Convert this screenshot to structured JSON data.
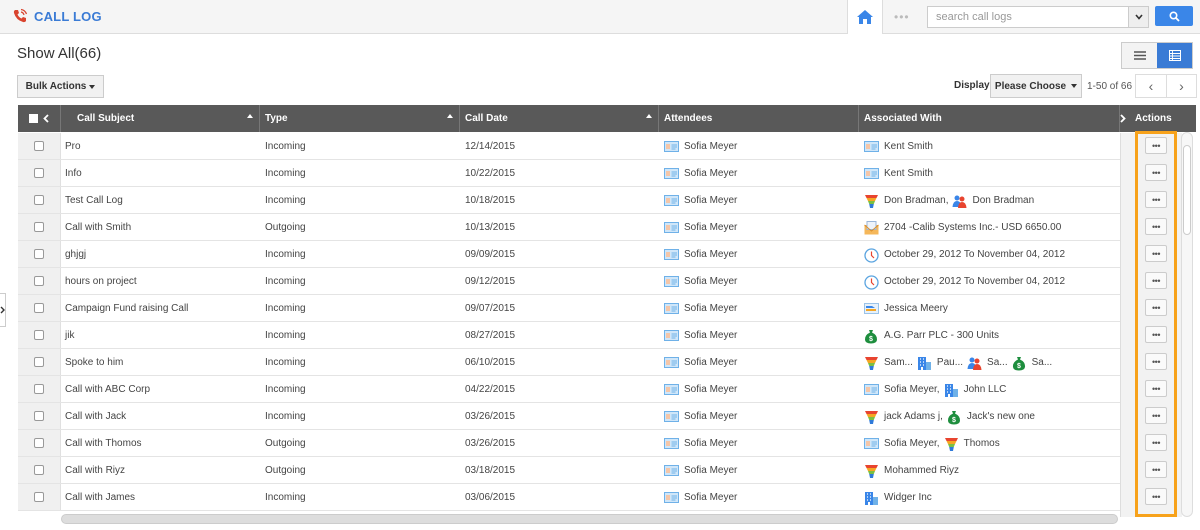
{
  "header": {
    "app_title": "CALL LOG",
    "search_placeholder": "search call logs",
    "more_label": "•••"
  },
  "toolbar": {
    "show_all": "Show All(66)",
    "bulk_actions": "Bulk Actions",
    "display_label": "Display",
    "display_select": "Please Choose",
    "page_count": "1-50 of 66",
    "prev": "‹",
    "next": "›"
  },
  "table": {
    "columns": [
      "Call Subject",
      "Type",
      "Call Date",
      "Attendees",
      "Associated With",
      "Actions"
    ],
    "action_label": "•••",
    "rows": [
      {
        "subject": "Pro",
        "type": "Incoming",
        "date": "12/14/2015",
        "attendee": "Sofia Meyer",
        "assoc": [
          {
            "icon": "contact-card-icon",
            "text": "Kent Smith"
          }
        ]
      },
      {
        "subject": "Info",
        "type": "Incoming",
        "date": "10/22/2015",
        "attendee": "Sofia Meyer",
        "assoc": [
          {
            "icon": "contact-card-icon",
            "text": "Kent Smith"
          }
        ]
      },
      {
        "subject": "Test Call Log",
        "type": "Incoming",
        "date": "10/18/2015",
        "attendee": "Sofia Meyer",
        "assoc": [
          {
            "icon": "lead-funnel-icon",
            "text": "Don Bradman,"
          },
          {
            "icon": "people-icon",
            "text": "Don Bradman"
          }
        ]
      },
      {
        "subject": "Call with Smith",
        "type": "Outgoing",
        "date": "10/13/2015",
        "attendee": "Sofia Meyer",
        "assoc": [
          {
            "icon": "invoice-envelope-icon",
            "text": "2704 -Calib Systems Inc.- USD 6650.00"
          }
        ]
      },
      {
        "subject": "ghjgj",
        "type": "Incoming",
        "date": "09/09/2015",
        "attendee": "Sofia Meyer",
        "assoc": [
          {
            "icon": "clock-icon",
            "text": "October 29, 2012 To November 04, 2012"
          }
        ]
      },
      {
        "subject": "hours on project",
        "type": "Incoming",
        "date": "09/12/2015",
        "attendee": "Sofia Meyer",
        "assoc": [
          {
            "icon": "clock-icon",
            "text": "October 29, 2012 To November 04, 2012"
          }
        ]
      },
      {
        "subject": "Campaign Fund raising Call",
        "type": "Incoming",
        "date": "09/07/2015",
        "attendee": "Sofia Meyer",
        "assoc": [
          {
            "icon": "campaign-icon",
            "text": "Jessica Meery"
          }
        ]
      },
      {
        "subject": "jik",
        "type": "Incoming",
        "date": "08/27/2015",
        "attendee": "Sofia Meyer",
        "assoc": [
          {
            "icon": "money-bag-icon",
            "text": "A.G. Parr PLC - 300 Units"
          }
        ]
      },
      {
        "subject": "Spoke to him",
        "type": "Incoming",
        "date": "06/10/2015",
        "attendee": "Sofia Meyer",
        "assoc": [
          {
            "icon": "lead-funnel-icon",
            "text": "Sam..."
          },
          {
            "icon": "building-icon",
            "text": "Pau..."
          },
          {
            "icon": "people-icon",
            "text": "Sa..."
          },
          {
            "icon": "money-bag-icon",
            "text": "Sa..."
          }
        ]
      },
      {
        "subject": "Call with ABC Corp",
        "type": "Incoming",
        "date": "04/22/2015",
        "attendee": "Sofia Meyer",
        "assoc": [
          {
            "icon": "contact-card-icon",
            "text": "Sofia Meyer,"
          },
          {
            "icon": "building-icon",
            "text": "John LLC"
          }
        ]
      },
      {
        "subject": "Call with Jack",
        "type": "Incoming",
        "date": "03/26/2015",
        "attendee": "Sofia Meyer",
        "assoc": [
          {
            "icon": "lead-funnel-icon",
            "text": "jack Adams j,"
          },
          {
            "icon": "money-bag-icon",
            "text": "Jack's new one"
          }
        ]
      },
      {
        "subject": "Call with Thomos",
        "type": "Outgoing",
        "date": "03/26/2015",
        "attendee": "Sofia Meyer",
        "assoc": [
          {
            "icon": "contact-card-icon",
            "text": "Sofia Meyer,"
          },
          {
            "icon": "lead-funnel-icon",
            "text": "Thomos"
          }
        ]
      },
      {
        "subject": "Call with Riyz",
        "type": "Outgoing",
        "date": "03/18/2015",
        "attendee": "Sofia Meyer",
        "assoc": [
          {
            "icon": "lead-funnel-icon",
            "text": "Mohammed Riyz"
          }
        ]
      },
      {
        "subject": "Call with James",
        "type": "Incoming",
        "date": "03/06/2015",
        "attendee": "Sofia Meyer",
        "assoc": [
          {
            "icon": "building-icon",
            "text": "Widger Inc"
          }
        ]
      }
    ]
  },
  "colors": {
    "brand_blue": "#3a7bd5",
    "header_gray": "#595959",
    "highlight_orange": "#f7a21b"
  }
}
